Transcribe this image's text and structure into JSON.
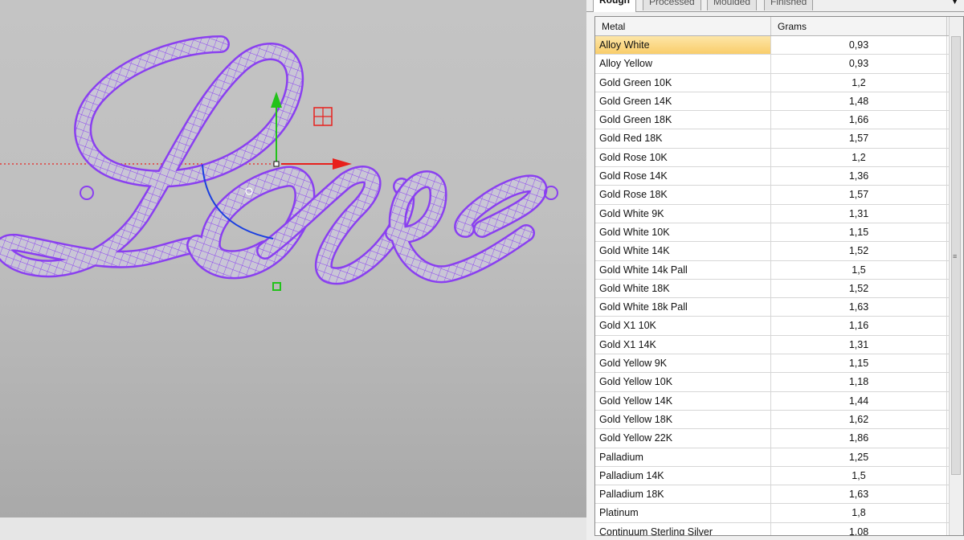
{
  "tabs": [
    {
      "label": "Rough",
      "active": true
    },
    {
      "label": "Processed",
      "active": false
    },
    {
      "label": "Moulded",
      "active": false
    },
    {
      "label": "Finished",
      "active": false
    }
  ],
  "table": {
    "columns": [
      "Metal",
      "Grams"
    ],
    "selected_row": 0,
    "rows": [
      {
        "metal": "Alloy White",
        "grams": "0,93"
      },
      {
        "metal": "Alloy Yellow",
        "grams": "0,93"
      },
      {
        "metal": "Gold Green 10K",
        "grams": "1,2"
      },
      {
        "metal": "Gold Green 14K",
        "grams": "1,48"
      },
      {
        "metal": "Gold Green 18K",
        "grams": "1,66"
      },
      {
        "metal": "Gold Red 18K",
        "grams": "1,57"
      },
      {
        "metal": "Gold Rose 10K",
        "grams": "1,2"
      },
      {
        "metal": "Gold Rose 14K",
        "grams": "1,36"
      },
      {
        "metal": "Gold Rose 18K",
        "grams": "1,57"
      },
      {
        "metal": "Gold White 9K",
        "grams": "1,31"
      },
      {
        "metal": "Gold White 10K",
        "grams": "1,15"
      },
      {
        "metal": "Gold White 14K",
        "grams": "1,52"
      },
      {
        "metal": "Gold White 14k Pall",
        "grams": "1,5"
      },
      {
        "metal": "Gold White 18K",
        "grams": "1,52"
      },
      {
        "metal": "Gold White 18k Pall",
        "grams": "1,63"
      },
      {
        "metal": "Gold X1 10K",
        "grams": "1,16"
      },
      {
        "metal": "Gold X1 14K",
        "grams": "1,31"
      },
      {
        "metal": "Gold Yellow 9K",
        "grams": "1,15"
      },
      {
        "metal": "Gold Yellow 10K",
        "grams": "1,18"
      },
      {
        "metal": "Gold Yellow 14K",
        "grams": "1,44"
      },
      {
        "metal": "Gold Yellow 18K",
        "grams": "1,62"
      },
      {
        "metal": "Gold Yellow 22K",
        "grams": "1,86"
      },
      {
        "metal": "Palladium",
        "grams": "1,25"
      },
      {
        "metal": "Palladium 14K",
        "grams": "1,5"
      },
      {
        "metal": "Palladium 18K",
        "grams": "1,63"
      },
      {
        "metal": "Platinum",
        "grams": "1,8"
      },
      {
        "metal": "Continuum Sterling Silver",
        "grams": "1,08"
      }
    ]
  },
  "colors": {
    "wireframe": "#8a3ff0",
    "gizmo_x": "#e8201c",
    "gizmo_y": "#22c21a",
    "gizmo_rotate": "#1a3fe0",
    "selection_highlight": "#f9cd6a"
  },
  "icons": {
    "tab_menu": "dropdown-arrow-icon",
    "scroll_grip": "grip-lines-icon"
  }
}
